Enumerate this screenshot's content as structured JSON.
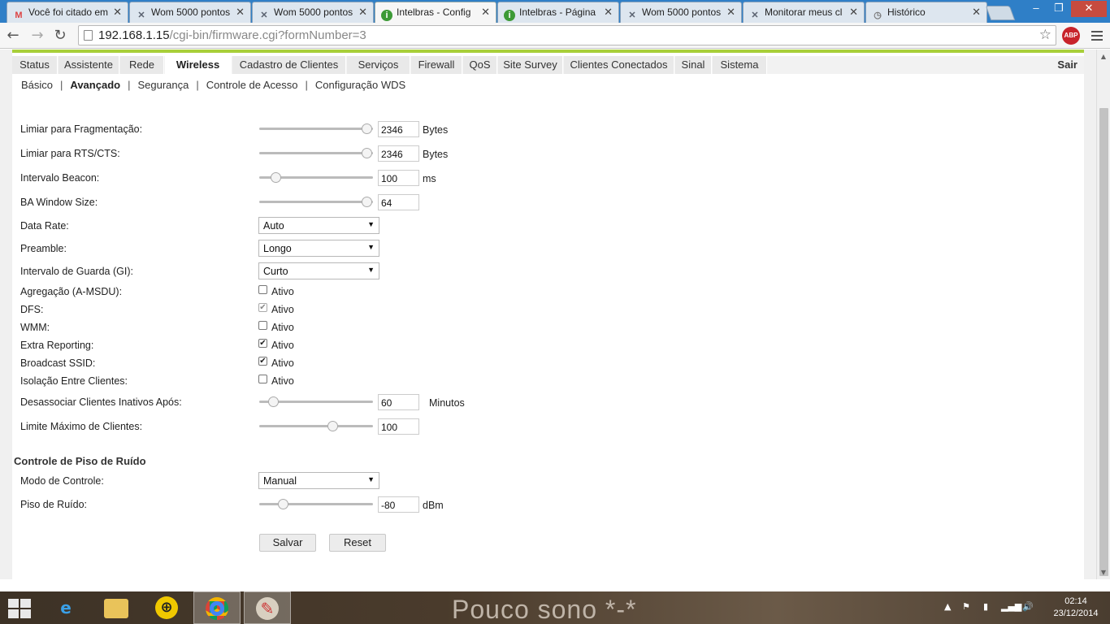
{
  "browser": {
    "tabs": [
      {
        "title": "Você foi citado em",
        "icon": "gmail-icon",
        "glyph": "M"
      },
      {
        "title": "Wom 5000 pontos",
        "icon": "wom-icon",
        "glyph": "✕"
      },
      {
        "title": "Wom 5000 pontos",
        "icon": "wom-icon",
        "glyph": "✕"
      },
      {
        "title": "Intelbras - Config",
        "icon": "intelbras-icon",
        "glyph": "i",
        "active": true
      },
      {
        "title": "Intelbras - Página",
        "icon": "intelbras-icon",
        "glyph": "i"
      },
      {
        "title": "Wom 5000 pontos",
        "icon": "wom-icon",
        "glyph": "✕"
      },
      {
        "title": "Monitorar meus cl",
        "icon": "wom-icon",
        "glyph": "✕"
      },
      {
        "title": "Histórico",
        "icon": "history-icon",
        "glyph": "◷"
      }
    ],
    "url_host": "192.168.1.15",
    "url_path": "/cgi-bin/firmware.cgi?formNumber=3",
    "abp_label": "ABP",
    "win_min": "–",
    "win_max": "❐",
    "win_close": "✕",
    "back_glyph": "←",
    "forward_glyph": "→",
    "reload_glyph": "↻",
    "star_glyph": "☆"
  },
  "mainnav": {
    "items": [
      "Status",
      "Assistente",
      "Rede",
      "Wireless",
      "Cadastro de Clientes",
      "Serviços",
      "Firewall",
      "QoS",
      "Site Survey",
      "Clientes Conectados",
      "Sinal",
      "Sistema"
    ],
    "active": "Wireless",
    "logout": "Sair"
  },
  "subnav": {
    "items": [
      "Básico",
      "Avançado",
      "Segurança",
      "Controle de Acesso",
      "Configuração WDS"
    ],
    "separator": "|",
    "active": "Avançado"
  },
  "form": {
    "frag": {
      "label": "Limiar para Fragmentação:",
      "value": "2346",
      "unit": "Bytes",
      "slider_fraction": 0.94
    },
    "rts": {
      "label": "Limiar para RTS/CTS:",
      "value": "2346",
      "unit": "Bytes",
      "slider_fraction": 0.94
    },
    "beacon": {
      "label": "Intervalo Beacon:",
      "value": "100",
      "unit": "ms",
      "slider_fraction": 0.14
    },
    "ba": {
      "label": "BA Window Size:",
      "value": "64",
      "slider_fraction": 0.94
    },
    "datarate": {
      "label": "Data Rate:",
      "value": "Auto"
    },
    "preamble": {
      "label": "Preamble:",
      "value": "Longo"
    },
    "gi": {
      "label": "Intervalo de Guarda (GI):",
      "value": "Curto"
    },
    "amsdu": {
      "label": "Agregação (A-MSDU):",
      "checkbox": "Ativo",
      "checked": false
    },
    "dfs": {
      "label": "DFS:",
      "checkbox": "Ativo",
      "checked": true,
      "disabled": true
    },
    "wmm": {
      "label": "WMM:",
      "checkbox": "Ativo",
      "checked": false
    },
    "extra": {
      "label": "Extra Reporting:",
      "checkbox": "Ativo",
      "checked": true
    },
    "bssid": {
      "label": "Broadcast SSID:",
      "checkbox": "Ativo",
      "checked": true
    },
    "isolation": {
      "label": "Isolação Entre Clientes:",
      "checkbox": "Ativo",
      "checked": false
    },
    "deassoc": {
      "label": "Desassociar Clientes Inativos Após:",
      "value": "60",
      "unit": "Minutos",
      "slider_fraction": 0.12
    },
    "maxclients": {
      "label": "Limite Máximo de Clientes:",
      "value": "100",
      "slider_fraction": 0.64
    }
  },
  "noise": {
    "heading": "Controle de Piso de Ruído",
    "mode": {
      "label": "Modo de Controle:",
      "value": "Manual"
    },
    "floor": {
      "label": "Piso de Ruído:",
      "value": "-80",
      "unit": "dBm",
      "slider_fraction": 0.21
    }
  },
  "buttons": {
    "save": "Salvar",
    "reset": "Reset"
  },
  "taskbar": {
    "wallpaper_text": "Pouco sono *-*",
    "time": "02:14",
    "date": "23/12/2014"
  },
  "colors": {
    "accent_green": "#a8cf3a",
    "taskbar": "#4a3b2c"
  }
}
